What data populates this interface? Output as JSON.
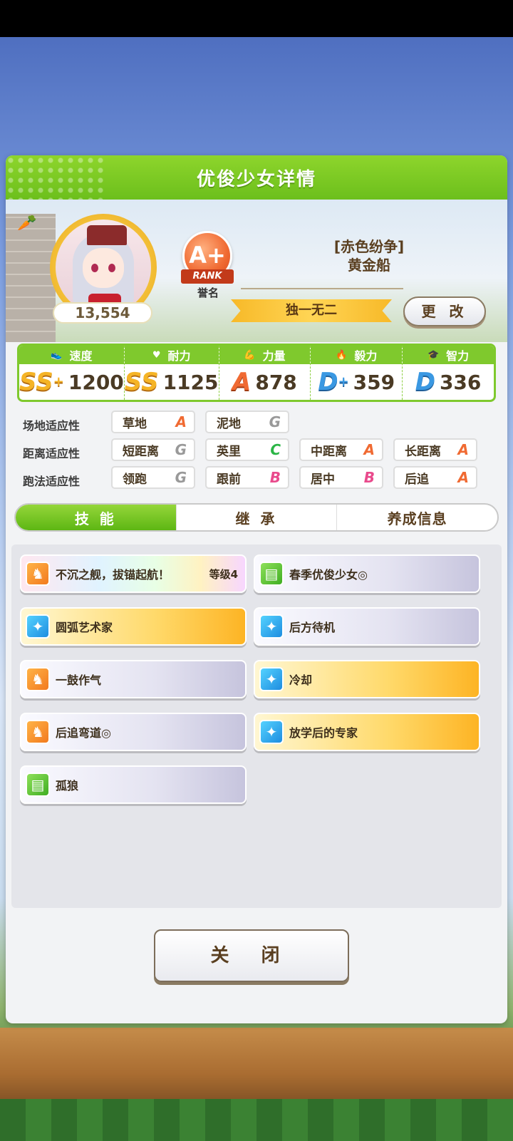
{
  "window": {
    "title": "优俊少女详情"
  },
  "profile": {
    "score": "13,554",
    "rank_grade": "A+",
    "rank_word": "RANK",
    "rank_label": "誉名",
    "epithet": "[赤色纷争]",
    "name": "黄金船",
    "title_banner": "独一无二",
    "change_label": "更 改"
  },
  "stats": [
    {
      "label": "速度",
      "icon": "shoe-icon",
      "grade": "SS",
      "plus": "+",
      "value": "1200",
      "grade_color": "gold"
    },
    {
      "label": "耐力",
      "icon": "heart-icon",
      "grade": "SS",
      "plus": "",
      "value": "1125",
      "grade_color": "gold"
    },
    {
      "label": "力量",
      "icon": "muscle-icon",
      "grade": "A",
      "plus": "",
      "value": "878",
      "grade_color": "orange"
    },
    {
      "label": "毅力",
      "icon": "flame-icon",
      "grade": "D",
      "plus": "+",
      "value": "359",
      "grade_color": "blue"
    },
    {
      "label": "智力",
      "icon": "graduation-cap-icon",
      "grade": "D",
      "plus": "",
      "value": "336",
      "grade_color": "blue"
    }
  ],
  "aptitude": {
    "track_label": "场地适应性",
    "distance_label": "距离适应性",
    "style_label": "跑法适应性",
    "track": [
      {
        "name": "草地",
        "grade": "A"
      },
      {
        "name": "泥地",
        "grade": "G"
      }
    ],
    "distance": [
      {
        "name": "短距离",
        "grade": "G"
      },
      {
        "name": "英里",
        "grade": "C"
      },
      {
        "name": "中距离",
        "grade": "A"
      },
      {
        "name": "长距离",
        "grade": "A"
      }
    ],
    "style": [
      {
        "name": "领跑",
        "grade": "G"
      },
      {
        "name": "跟前",
        "grade": "B"
      },
      {
        "name": "居中",
        "grade": "B"
      },
      {
        "name": "后追",
        "grade": "A"
      }
    ]
  },
  "tabs": [
    {
      "label": "技 能",
      "active": true
    },
    {
      "label": "继 承"
    },
    {
      "label": "养成信息"
    }
  ],
  "skills": [
    {
      "name": "不沉之舰，拔锚起航！",
      "level": "等级4",
      "icon": "horse-emblem-icon",
      "style": "rainbow"
    },
    {
      "name": "春季优俊少女◎",
      "icon": "green-card-icon",
      "style": "gray"
    },
    {
      "name": "圆弧艺术家",
      "icon": "sparkle-icon",
      "style": "gold"
    },
    {
      "name": "后方待机",
      "icon": "sparkle-icon",
      "style": "gray"
    },
    {
      "name": "一鼓作气",
      "icon": "horse-emblem-icon",
      "style": "gray"
    },
    {
      "name": "冷却",
      "icon": "sparkle-icon",
      "style": "gold"
    },
    {
      "name": "后追弯道◎",
      "icon": "horse-emblem-icon",
      "style": "gray"
    },
    {
      "name": "放学后的专家",
      "icon": "sparkle-icon",
      "style": "gold"
    },
    {
      "name": "孤狼",
      "icon": "green-card-icon",
      "style": "gray"
    }
  ],
  "close_label": "关 闭"
}
